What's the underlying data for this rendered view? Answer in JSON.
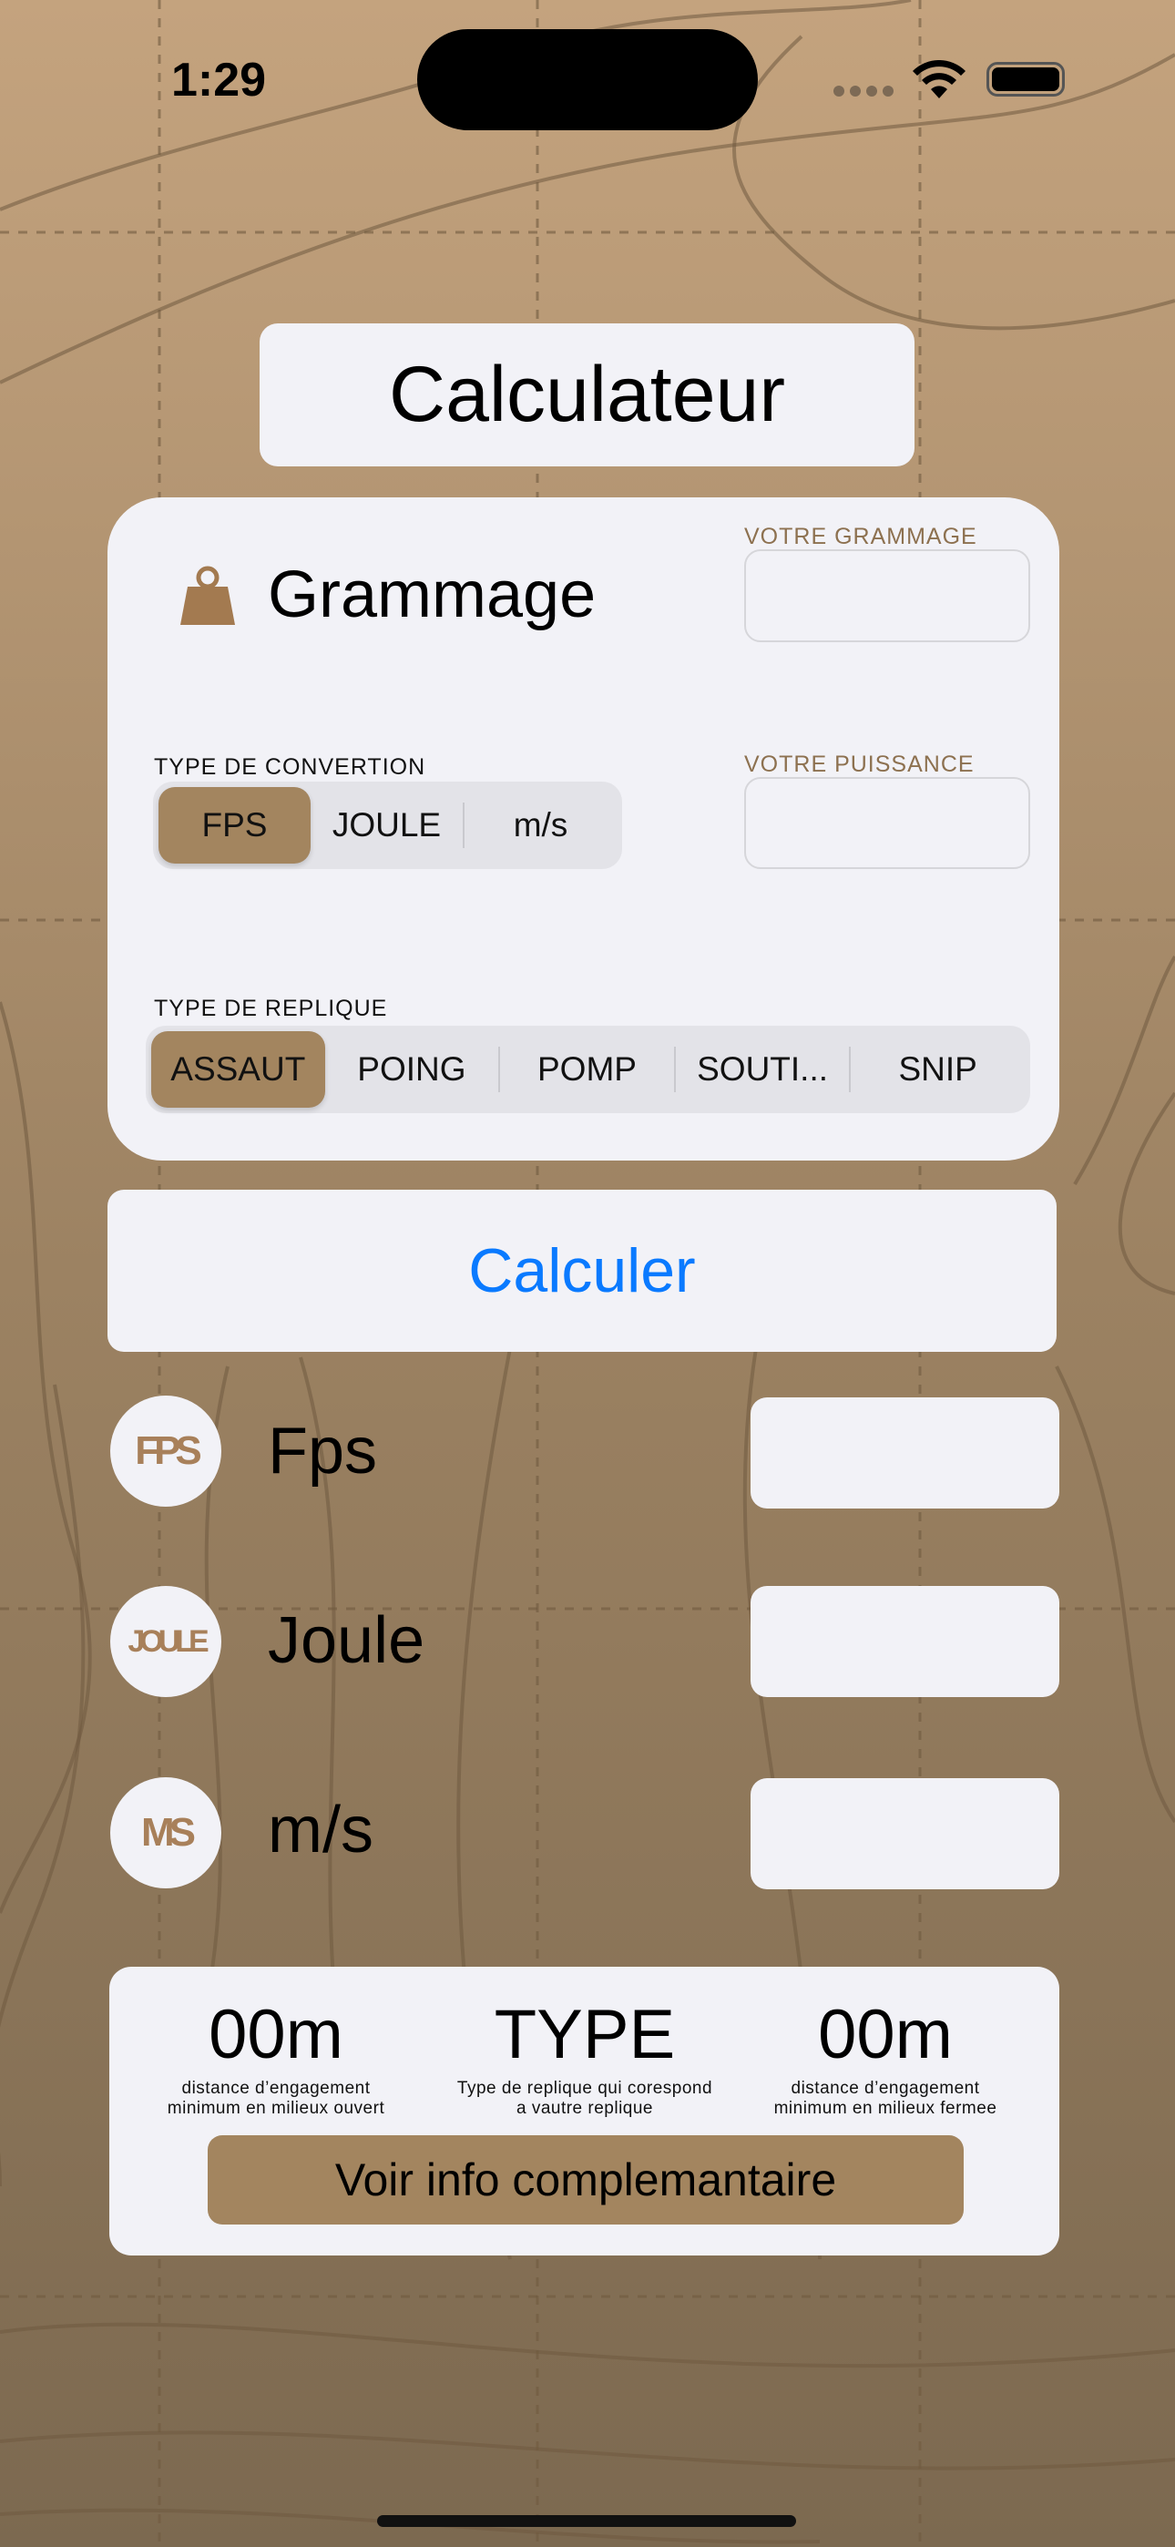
{
  "status_bar": {
    "time": "1:29"
  },
  "header": {
    "title": "Calculateur"
  },
  "form": {
    "weight_icon": "weight-icon",
    "weight_title": "Grammage",
    "grammage_label": "VOTRE GRAMMAGE",
    "grammage_value": "",
    "power_label": "VOTRE PUISSANCE",
    "power_value": "",
    "conversion_label": "TYPE DE CONVERTION",
    "conversion_options": [
      "FPS",
      "JOULE",
      "m/s"
    ],
    "conversion_selected": "FPS",
    "replica_label": "TYPE DE REPLIQUE",
    "replica_options": [
      "ASSAUT",
      "POING",
      "POMP",
      "SOUTI...",
      "SNIP"
    ],
    "replica_selected": "ASSAUT"
  },
  "calculate_button": {
    "label": "Calculer",
    "color": "#0a7aff"
  },
  "results": [
    {
      "badge": "FPS",
      "label": "Fps",
      "value": ""
    },
    {
      "badge": "JOULE",
      "label": "Joule",
      "value": ""
    },
    {
      "badge": "MS",
      "label": "m/s",
      "value": ""
    }
  ],
  "summary": {
    "open_distance": "00m",
    "open_desc_1": "distance d’engagement",
    "open_desc_2": "minimum en milieux ouvert",
    "type": "TYPE",
    "type_desc_1": "Type de replique qui corespond",
    "type_desc_2": "a vautre replique",
    "closed_distance": "00m",
    "closed_desc_1": "distance d’engagement",
    "closed_desc_2": "minimum en milieux fermee",
    "info_button": "Voir info complemantaire"
  },
  "colors": {
    "accent": "#a3855f",
    "card": "#f2f2f7",
    "background_top": "#c4a37e",
    "background_bottom": "#7c6950"
  }
}
